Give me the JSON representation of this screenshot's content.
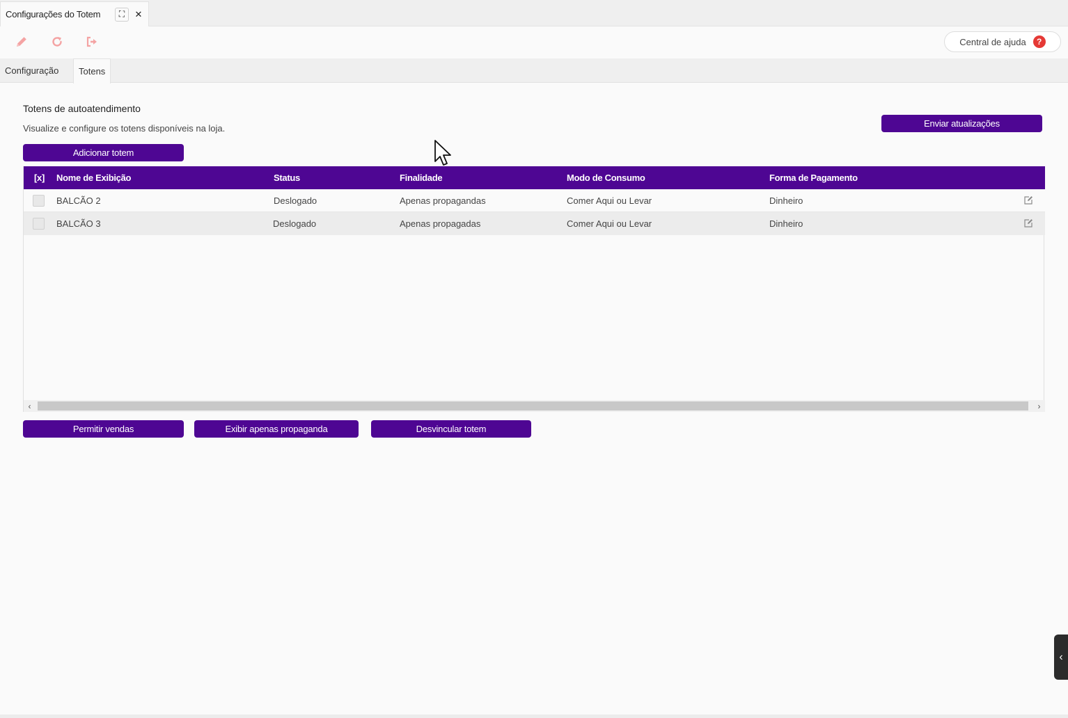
{
  "window": {
    "title": "Configurações do Totem",
    "expand_icon": "⛶",
    "close_icon": "✕"
  },
  "toolbar": {
    "edit_icon": "pencil-icon",
    "refresh_icon": "refresh-icon",
    "exit_icon": "sign-out-icon",
    "help_label": "Central de ajuda",
    "help_badge": "?"
  },
  "tabs": [
    {
      "label": "Configuração",
      "active": false
    },
    {
      "label": "Totens",
      "active": true
    }
  ],
  "section": {
    "title": "Totens de autoatendimento",
    "description": "Visualize e configure os totens disponíveis na loja.",
    "add_button": "Adicionar totem",
    "send_updates_button": "Enviar atualizações"
  },
  "table": {
    "columns": [
      "[x]",
      "Nome de Exibição",
      "Status",
      "Finalidade",
      "Modo de Consumo",
      "Forma de Pagamento"
    ],
    "rows": [
      {
        "name": "BALCÃO 2",
        "status": "Deslogado",
        "purpose": "Apenas propagandas",
        "consumption": "Comer Aqui ou Levar",
        "payment": "Dinheiro"
      },
      {
        "name": "BALCÃO 3",
        "status": "Deslogado",
        "purpose": "Apenas propagadas",
        "consumption": "Comer Aqui ou Levar",
        "payment": "Dinheiro"
      }
    ]
  },
  "actions": {
    "allow_sales": "Permitir vendas",
    "ads_only": "Exibir apenas propaganda",
    "unlink": "Desvincular totem"
  },
  "colors": {
    "primary": "#4e0693",
    "toolbar_icon": "#f4a3a3",
    "help_badge": "#e53935"
  }
}
